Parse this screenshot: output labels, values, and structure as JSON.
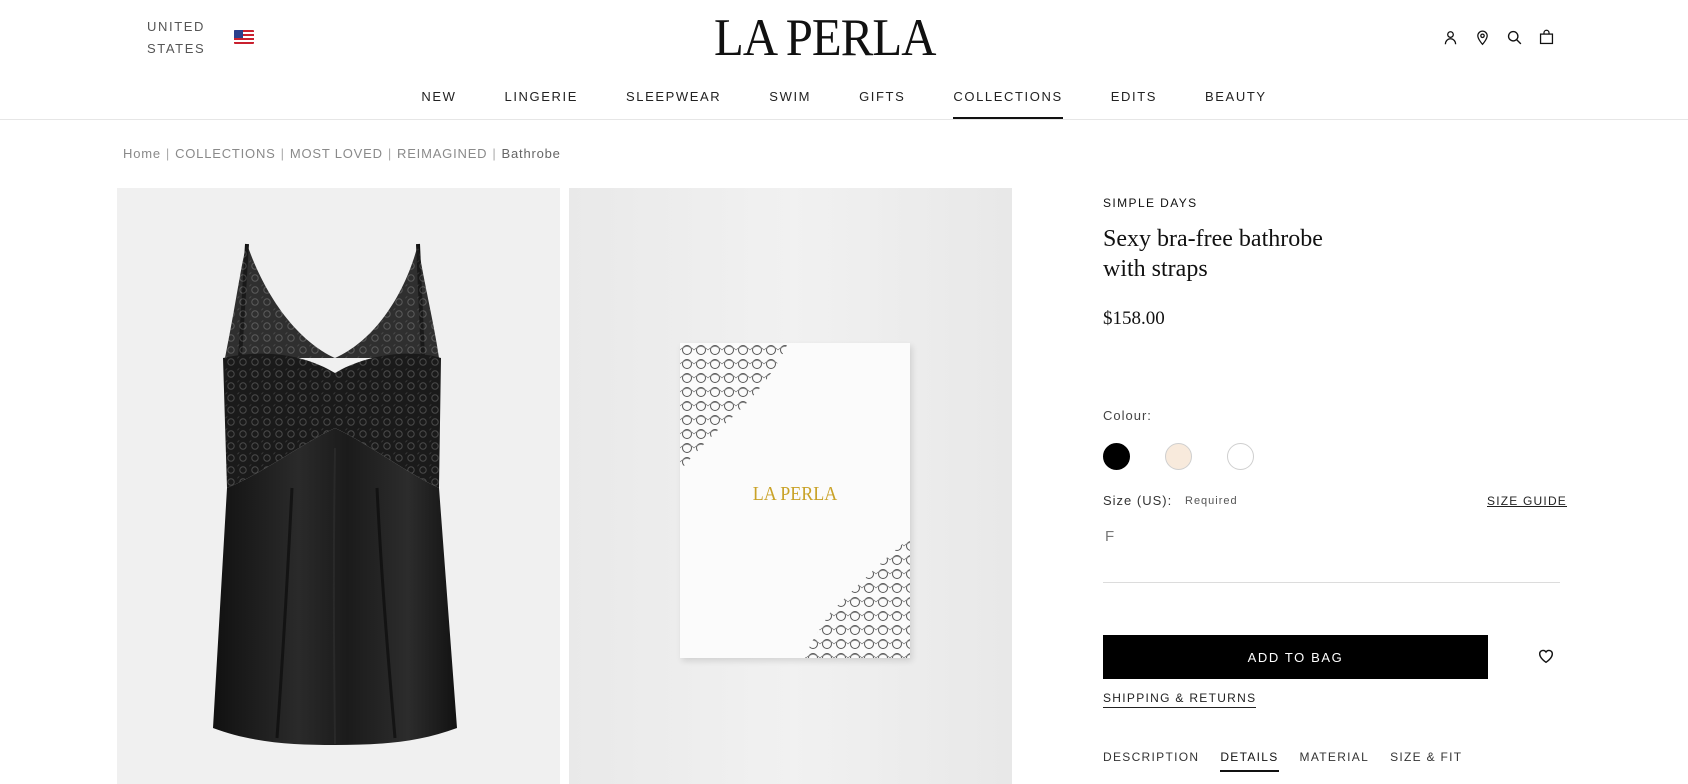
{
  "header": {
    "locale_line1": "UNITED",
    "locale_line2": "STATES",
    "logo": "LA PERLA",
    "nav": [
      "NEW",
      "LINGERIE",
      "SLEEPWEAR",
      "SWIM",
      "GIFTS",
      "COLLECTIONS",
      "EDITS",
      "BEAUTY"
    ],
    "active_nav": "COLLECTIONS",
    "icons": [
      "account-icon",
      "store-locator-icon",
      "search-icon",
      "bag-icon"
    ]
  },
  "breadcrumb": {
    "home": "Home",
    "collections": "COLLECTIONS",
    "most_loved": "MOST LOVED",
    "reimagined": "REIMAGINED",
    "current": "Bathrobe"
  },
  "gallery": {
    "box_logo": "LA PERLA"
  },
  "product": {
    "brand": "SIMPLE DAYS",
    "title_line1": "Sexy bra-free bathrobe",
    "title_line2": "with straps",
    "price": "$158.00",
    "colour_label": "Colour:",
    "colours": [
      "#000000",
      "#f8eadc",
      "#ffffff"
    ],
    "size_label": "Size (US):",
    "size_required": "Required",
    "size_guide": "SIZE GUIDE",
    "size_option": "F",
    "add_to_bag": "ADD TO BAG",
    "shipping": "SHIPPING & RETURNS",
    "tabs": [
      "DESCRIPTION",
      "DETAILS",
      "MATERIAL",
      "SIZE & FIT"
    ],
    "active_tab": "DETAILS"
  }
}
